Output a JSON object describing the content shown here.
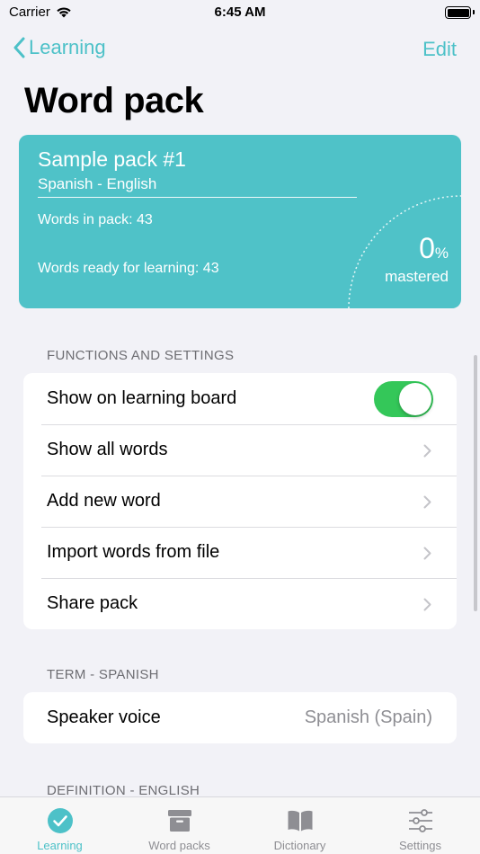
{
  "status": {
    "carrier": "Carrier",
    "time": "6:45 AM"
  },
  "nav": {
    "back_label": "Learning",
    "edit_label": "Edit"
  },
  "title": "Word pack",
  "pack": {
    "name": "Sample pack #1",
    "languages": "Spanish - English",
    "words_in_pack": "Words in pack: 43",
    "words_ready": "Words ready for learning: 43",
    "mastered_value": "0",
    "mastered_unit": "%",
    "mastered_label": "mastered",
    "mastered_fraction": 0
  },
  "sections": {
    "functions": {
      "header": "FUNCTIONS AND SETTINGS",
      "rows": [
        {
          "label": "Show on learning board",
          "type": "toggle",
          "on": true
        },
        {
          "label": "Show all words",
          "type": "disclosure"
        },
        {
          "label": "Add new word",
          "type": "disclosure"
        },
        {
          "label": "Import words from file",
          "type": "disclosure"
        },
        {
          "label": "Share pack",
          "type": "disclosure"
        }
      ]
    },
    "term": {
      "header": "TERM - SPANISH",
      "rows": [
        {
          "label": "Speaker voice",
          "value": "Spanish (Spain)"
        }
      ]
    },
    "definition": {
      "header": "DEFINITION - ENGLISH"
    }
  },
  "tabs": [
    {
      "label": "Learning",
      "icon": "checkmark-circle-icon",
      "active": true
    },
    {
      "label": "Word packs",
      "icon": "archive-box-icon",
      "active": false
    },
    {
      "label": "Dictionary",
      "icon": "book-icon",
      "active": false
    },
    {
      "label": "Settings",
      "icon": "sliders-icon",
      "active": false
    }
  ],
  "colors": {
    "accent": "#4dc1c8",
    "card": "#4fc2c8",
    "toggle_on": "#34c759",
    "background": "#f2f2f7"
  }
}
